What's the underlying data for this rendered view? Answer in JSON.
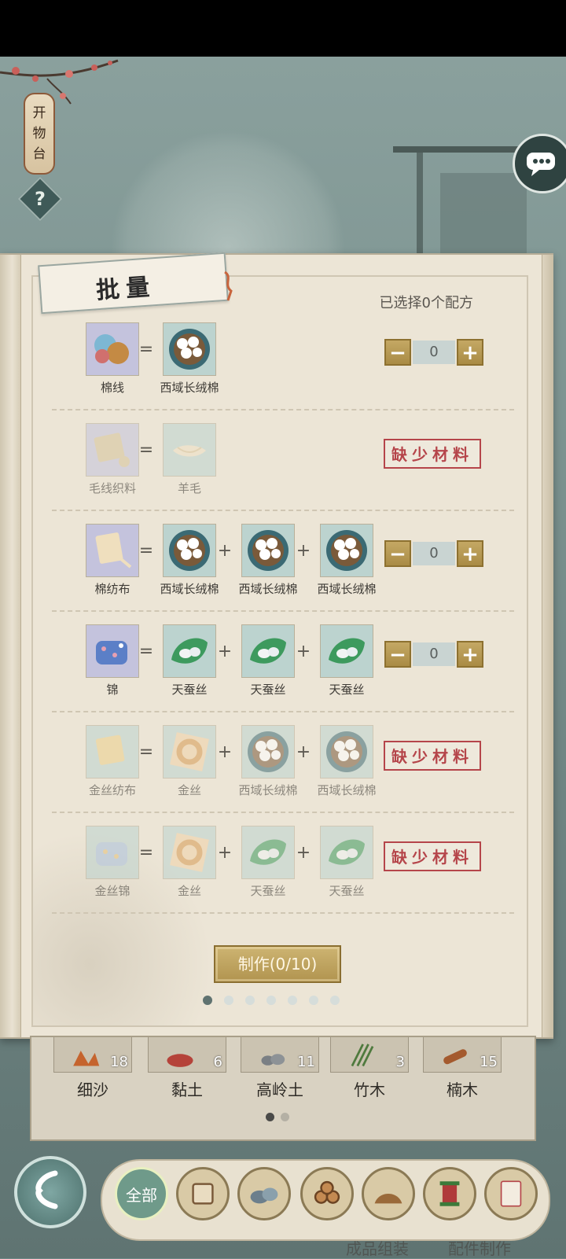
{
  "side_panel": {
    "lantern_chars": [
      "开",
      "物",
      "台"
    ],
    "help_symbol": "?"
  },
  "book": {
    "title": "批量",
    "selected_text": "已选择0个配方",
    "make_button": "制作(0/10)",
    "page_count": 7,
    "active_page": 0,
    "recipes": [
      {
        "product": "棉线",
        "product_icon": "cotton-thread-icon",
        "ingredients": [
          {
            "name": "西域长绒棉",
            "icon": "cotton-boll-icon"
          }
        ],
        "status": "stepper",
        "quantity": "0"
      },
      {
        "product": "毛线织料",
        "product_icon": "wool-fabric-icon",
        "ingredients": [
          {
            "name": "羊毛",
            "icon": "wool-icon"
          }
        ],
        "status": "missing",
        "missing_text": "缺少材料"
      },
      {
        "product": "棉纺布",
        "product_icon": "cotton-cloth-icon",
        "ingredients": [
          {
            "name": "西域长绒棉",
            "icon": "cotton-boll-icon"
          },
          {
            "name": "西域长绒棉",
            "icon": "cotton-boll-icon"
          },
          {
            "name": "西域长绒棉",
            "icon": "cotton-boll-icon"
          }
        ],
        "status": "stepper",
        "quantity": "0"
      },
      {
        "product": "锦",
        "product_icon": "brocade-icon",
        "ingredients": [
          {
            "name": "天蚕丝",
            "icon": "silk-cocoon-icon"
          },
          {
            "name": "天蚕丝",
            "icon": "silk-cocoon-icon"
          },
          {
            "name": "天蚕丝",
            "icon": "silk-cocoon-icon"
          }
        ],
        "status": "stepper",
        "quantity": "0"
      },
      {
        "product": "金丝纺布",
        "product_icon": "gold-cloth-icon",
        "ingredients": [
          {
            "name": "金丝",
            "icon": "gold-thread-icon"
          },
          {
            "name": "西域长绒棉",
            "icon": "cotton-boll-icon"
          },
          {
            "name": "西域长绒棉",
            "icon": "cotton-boll-icon"
          }
        ],
        "status": "missing",
        "missing_text": "缺少材料"
      },
      {
        "product": "金丝锦",
        "product_icon": "gold-brocade-icon",
        "ingredients": [
          {
            "name": "金丝",
            "icon": "gold-thread-icon"
          },
          {
            "name": "天蚕丝",
            "icon": "silk-cocoon-icon"
          },
          {
            "name": "天蚕丝",
            "icon": "silk-cocoon-icon"
          }
        ],
        "status": "missing",
        "missing_text": "缺少材料"
      }
    ]
  },
  "inventory": {
    "items": [
      {
        "name": "细沙",
        "count": "18",
        "icon": "sand-icon"
      },
      {
        "name": "黏土",
        "count": "6",
        "icon": "clay-icon"
      },
      {
        "name": "高岭土",
        "count": "11",
        "icon": "kaolin-icon"
      },
      {
        "name": "竹木",
        "count": "3",
        "icon": "bamboo-icon"
      },
      {
        "name": "楠木",
        "count": "15",
        "icon": "nanmu-wood-icon"
      }
    ],
    "page_count": 2,
    "active_page": 0
  },
  "categories": [
    {
      "label": "全部",
      "icon": "all-icon",
      "active": true
    },
    {
      "label": "",
      "icon": "scroll-icon",
      "active": false
    },
    {
      "label": "",
      "icon": "stone-icon",
      "active": false
    },
    {
      "label": "",
      "icon": "logs-icon",
      "active": false
    },
    {
      "label": "",
      "icon": "soil-icon",
      "active": false
    },
    {
      "label": "",
      "icon": "spool-icon",
      "active": false
    },
    {
      "label": "",
      "icon": "paper-icon",
      "active": false
    }
  ],
  "bottom_ghost_labels": [
    "成品组装",
    "配件制作"
  ],
  "colors": {
    "accent_gold": "#b1944f",
    "missing_red": "#b5454a",
    "paper": "#ece5d6"
  }
}
